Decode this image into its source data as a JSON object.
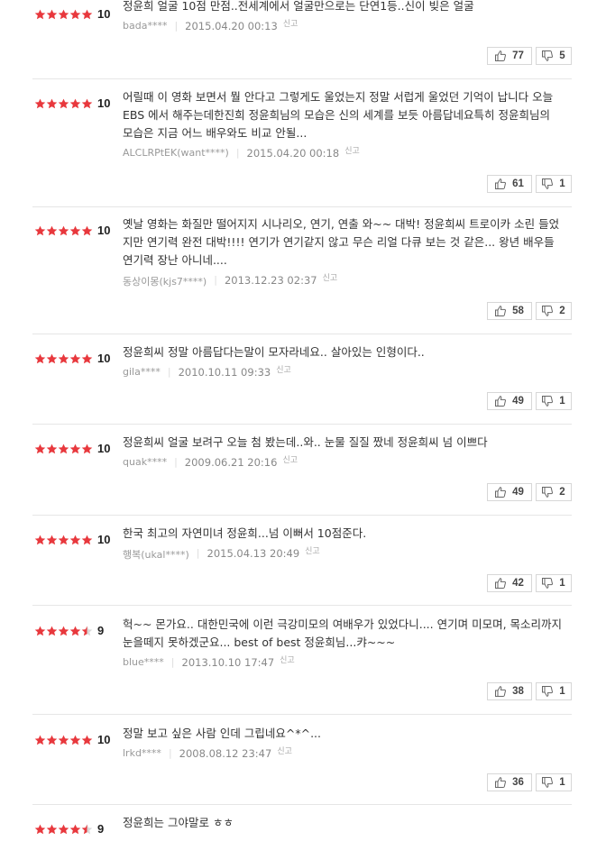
{
  "colors": {
    "star": "#e8383d",
    "star_empty": "#d8d8d8"
  },
  "reviews": [
    {
      "score": "10",
      "stars": 5,
      "text": "정윤희 얼굴 10점 만점..전세계에서 얼굴만으로는 단연1등..신이 빚은 얼굴",
      "user": "bada****",
      "date": "2015.04.20 00:13",
      "report": "신고",
      "likes": "77",
      "dislikes": "5"
    },
    {
      "score": "10",
      "stars": 5,
      "text": "어릴때 이 영화 보면서 뭘 안다고 그렇게도 울었는지 정말 서럽게 울었던 기억이 납니다 오늘 EBS 에서 해주는데한진희 정윤희님의 모습은 신의 세계를 보듯 아름답네요특히 정윤희님의 모습은 지금 어느 배우와도 비교 안될...",
      "user": "ALCLRPtEK(want****)",
      "date": "2015.04.20 00:18",
      "report": "신고",
      "likes": "61",
      "dislikes": "1"
    },
    {
      "score": "10",
      "stars": 5,
      "text": "옛날 영화는 화질만 떨어지지 시나리오, 연기, 연출 와~~ 대박! 정윤희씨 트로이카 소린 들었지만 연기력 완전 대박!!!! 연기가 연기같지 않고 무슨 리얼 다큐 보는 것 같은... 왕년 배우들 연기력 장난 아니네....",
      "user": "동상이몽(kjs7****)",
      "date": "2013.12.23 02:37",
      "report": "신고",
      "likes": "58",
      "dislikes": "2"
    },
    {
      "score": "10",
      "stars": 5,
      "text": "정윤희씨 정말 아름답다는말이 모자라네요.. 살아있는 인형이다..",
      "user": "gila****",
      "date": "2010.10.11 09:33",
      "report": "신고",
      "likes": "49",
      "dislikes": "1"
    },
    {
      "score": "10",
      "stars": 5,
      "text": "정윤희씨 얼굴 보려구 오늘 첨 봤는데..와.. 눈물 질질 짰네 정윤희씨 넘 이쁘다",
      "user": "quak****",
      "date": "2009.06.21 20:16",
      "report": "신고",
      "likes": "49",
      "dislikes": "2"
    },
    {
      "score": "10",
      "stars": 5,
      "text": "한국 최고의 자연미녀 정윤희...넘 이뻐서 10점준다.",
      "user": "행복(ukal****)",
      "date": "2015.04.13 20:49",
      "report": "신고",
      "likes": "42",
      "dislikes": "1"
    },
    {
      "score": "9",
      "stars": 4.5,
      "text": "헉~~ 몬가요.. 대한민국에 이런 극강미모의 여배우가 있었다니.... 연기며 미모며, 목소리까지 눈을떼지 못하겠군요... best of best 정윤희님...캬~~~",
      "user": "blue****",
      "date": "2013.10.10 17:47",
      "report": "신고",
      "likes": "38",
      "dislikes": "1"
    },
    {
      "score": "10",
      "stars": 5,
      "text": "정말 보고 싶은 사람 인데 그립네요^*^...",
      "user": "lrkd****",
      "date": "2008.08.12 23:47",
      "report": "신고",
      "likes": "36",
      "dislikes": "1"
    },
    {
      "score": "9",
      "stars": 4.5,
      "text": "정윤희는 그야말로 ㅎㅎ",
      "user": "",
      "date": "",
      "report": "",
      "likes": "",
      "dislikes": ""
    }
  ]
}
